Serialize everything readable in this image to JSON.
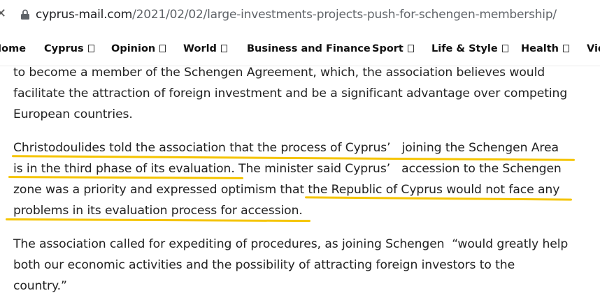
{
  "browser": {
    "url_domain": "cyprus-mail.com",
    "url_path": "/2021/02/02/large-investments-projects-push-for-schengen-membership/"
  },
  "nav": {
    "items": [
      "Home",
      "Cyprus",
      "Opinion",
      "World",
      "Business and Finance",
      "Sport",
      "Life & Style",
      "Health",
      "Vid"
    ]
  },
  "article": {
    "lines": [
      "to become a member of the Schengen Agreement, which, the association believes would",
      "facilitate the attraction of foreign investment and be a significant advantage over competing",
      "European countries.",
      "Christodoulides told the association that the process of Cyprus’   joining the Schengen Area",
      "is in the third phase of its evaluation. The minister said Cyprus’   accession to the Schengen",
      "zone was a priority and expressed optimism that the Republic of Cyprus would not face any",
      "problems in its evaluation process for accession.",
      "The association called for expediting of procedures, as joining Schengen  “would greatly help",
      "both our economic activities and the possibility of attracting foreign investors to the",
      "country.”"
    ]
  },
  "colors": {
    "highlight": "#f5c400"
  }
}
